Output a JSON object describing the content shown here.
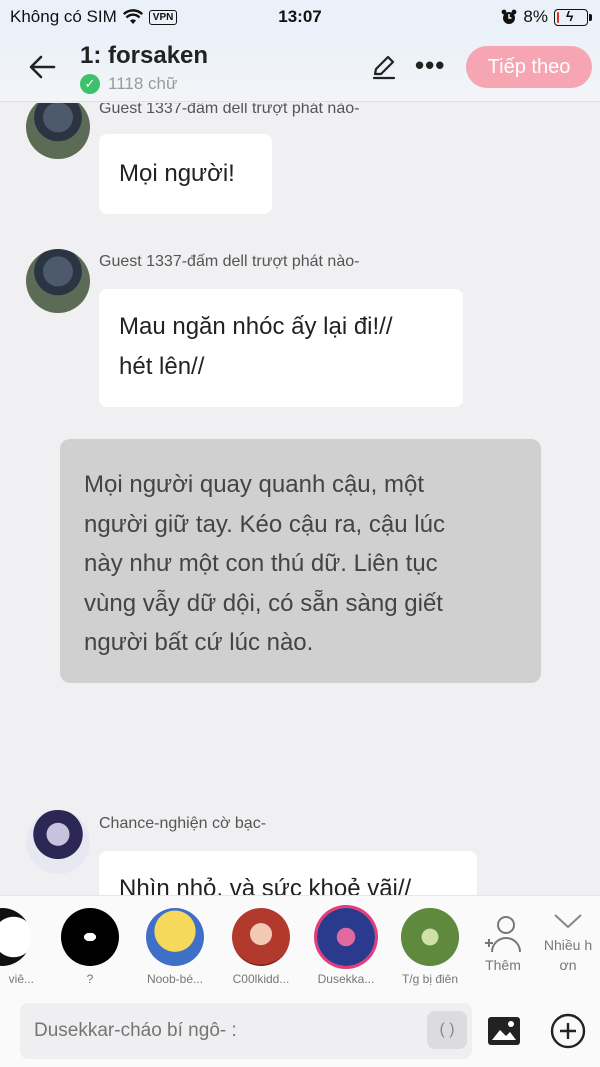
{
  "status": {
    "carrier": "Không có SIM",
    "vpn": "VPN",
    "time": "13:07",
    "battery": "8%",
    "battery_level": 0.08
  },
  "header": {
    "title": "1: forsaken",
    "word_count": "1118 chữ",
    "next_label": "Tiếp theo",
    "accent_color": "#f6a5b3"
  },
  "messages": [
    {
      "sender": "Guest 1337-đấm dell trượt phát nào-",
      "lines": [
        "Mọi người!"
      ]
    },
    {
      "sender": "Guest 1337-đấm dell trượt phát nào-",
      "lines": [
        "Mau ngăn nhóc ấy lại đi!//",
        "hét lên//"
      ]
    },
    {
      "narration": [
        "Mọi người quay quanh cậu, một",
        "người giữ tay. Kéo cậu ra, cậu lúc",
        "này như một con thú dữ. Liên tục",
        "vùng vẫy dữ dội, có sẵn sàng giết",
        "người bất cứ lúc nào."
      ]
    },
    {
      "sender": "Chance-nghiện cờ bạc-",
      "lines": [
        "Nhìn nhỏ, và sức khoẻ vãi//"
      ]
    }
  ],
  "characters": [
    {
      "name": "viê..."
    },
    {
      "name": "?"
    },
    {
      "name": "Noob-bé..."
    },
    {
      "name": "C00lkidd..."
    },
    {
      "name": "Dusekka...",
      "selected": true
    },
    {
      "name": "T/g bị điên"
    }
  ],
  "strip": {
    "add_label": "Thêm",
    "expand_label_1": "Nhiều h",
    "expand_label_2": "ơn"
  },
  "input": {
    "placeholder": "Dusekkar-cháo bí ngô- :",
    "paren_label": "( )"
  }
}
